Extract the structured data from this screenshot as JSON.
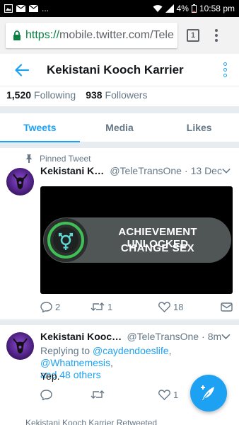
{
  "status_bar": {
    "left_icons": [
      "image-icon",
      "mail-icon",
      "mail-icon"
    ],
    "overflow": "...",
    "battery": "4%",
    "time": "10:58 pm"
  },
  "browser": {
    "url_scheme": "https://",
    "url_rest": "mobile.twitter.com/Tele",
    "tab_count": "1"
  },
  "profile_header": {
    "title": "Kekistani Kooch Karrier"
  },
  "counts": {
    "following_value": "1,520",
    "following_label": "Following",
    "followers_value": "938",
    "followers_label": "Followers"
  },
  "tabs": [
    {
      "label": "Tweets",
      "active": true
    },
    {
      "label": "Media",
      "active": false
    },
    {
      "label": "Likes",
      "active": false
    }
  ],
  "tweets": [
    {
      "pinned_label": "Pinned Tweet",
      "name": "Kekistani Koo…",
      "handle": "@TeleTransOne",
      "dot": "·",
      "date": "13 Dec",
      "media": {
        "line1": "ACHIEVEMENT UNLOCKED",
        "line2": "CHANGE SEX"
      },
      "reply_count": "2",
      "retweet_count": "1",
      "like_count": "18"
    },
    {
      "name": "Kekistani Kooch …",
      "handle": "@TeleTransOne",
      "dot": "·",
      "date": "8m",
      "replying_to_prefix": "Replying to",
      "mention_1": "@caydendoeslife",
      "separator": ",",
      "mention_2": "@Whatnemesis",
      "mention_3": "and 48 others",
      "text": "Yep.",
      "like_count": "1"
    }
  ],
  "peek_text": "Kekistani Kooch Karrier Retweeted",
  "colors": {
    "accent": "#1da1f2",
    "muted": "#657786",
    "text": "#14171a",
    "secure_green": "#0b8043"
  }
}
